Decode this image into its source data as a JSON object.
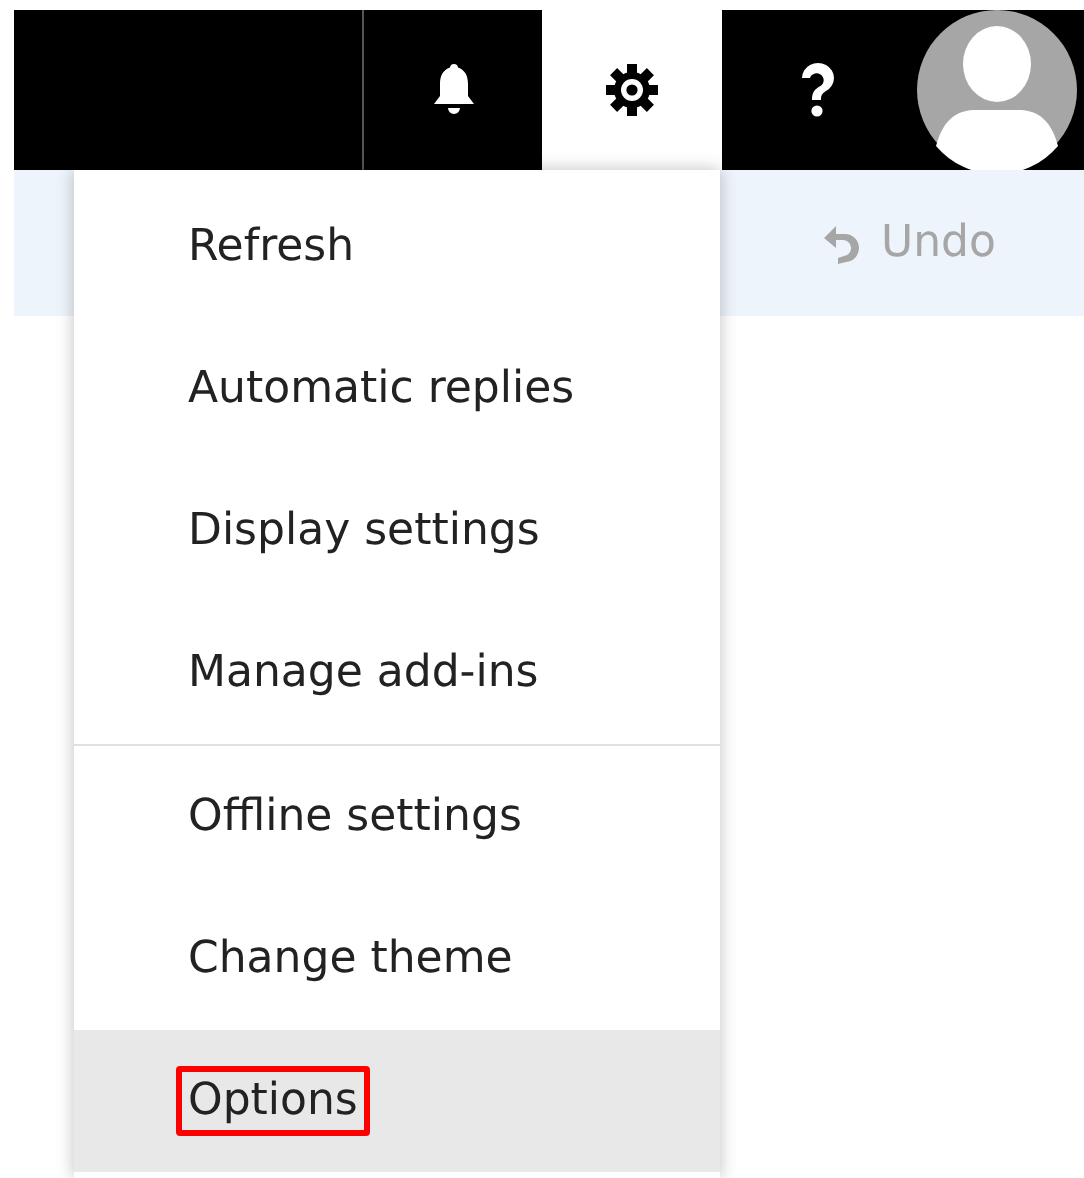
{
  "top_bar": {
    "buttons": [
      {
        "kind": "bell",
        "selected": false
      },
      {
        "kind": "gear",
        "selected": true
      },
      {
        "kind": "help",
        "selected": false
      },
      {
        "kind": "avatar",
        "selected": false
      }
    ]
  },
  "command_bar": {
    "undo": {
      "label": "Undo",
      "disabled": true
    }
  },
  "settings_menu": {
    "groups": [
      [
        {
          "label": "Refresh",
          "hovered": false,
          "outlined": false
        },
        {
          "label": "Automatic replies",
          "hovered": false,
          "outlined": false
        },
        {
          "label": "Display settings",
          "hovered": false,
          "outlined": false
        },
        {
          "label": "Manage add-ins",
          "hovered": false,
          "outlined": false
        }
      ],
      [
        {
          "label": "Offline settings",
          "hovered": false,
          "outlined": false
        },
        {
          "label": "Change theme",
          "hovered": false,
          "outlined": false
        },
        {
          "label": "Options",
          "hovered": true,
          "outlined": true
        }
      ]
    ]
  }
}
